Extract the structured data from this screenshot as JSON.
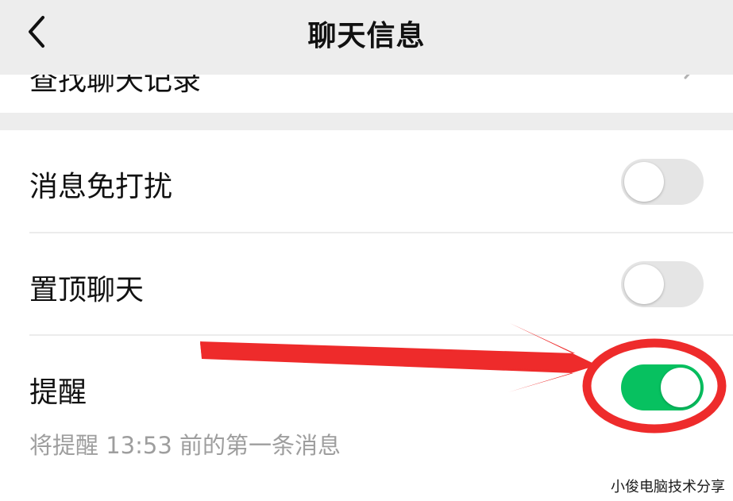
{
  "header": {
    "title": "聊天信息"
  },
  "clipped_row": {
    "label": "查找聊天记录"
  },
  "settings": {
    "mute": {
      "label": "消息免打扰",
      "enabled": false
    },
    "pin": {
      "label": "置顶聊天",
      "enabled": false
    },
    "reminder": {
      "label": "提醒",
      "enabled": true,
      "hint": "将提醒 13:53 前的第一条消息"
    }
  },
  "watermark": "小俊电脑技术分享",
  "colors": {
    "toggle_on": "#07c160",
    "toggle_off": "#e5e5e5",
    "annotation": "#ee2b2b"
  }
}
